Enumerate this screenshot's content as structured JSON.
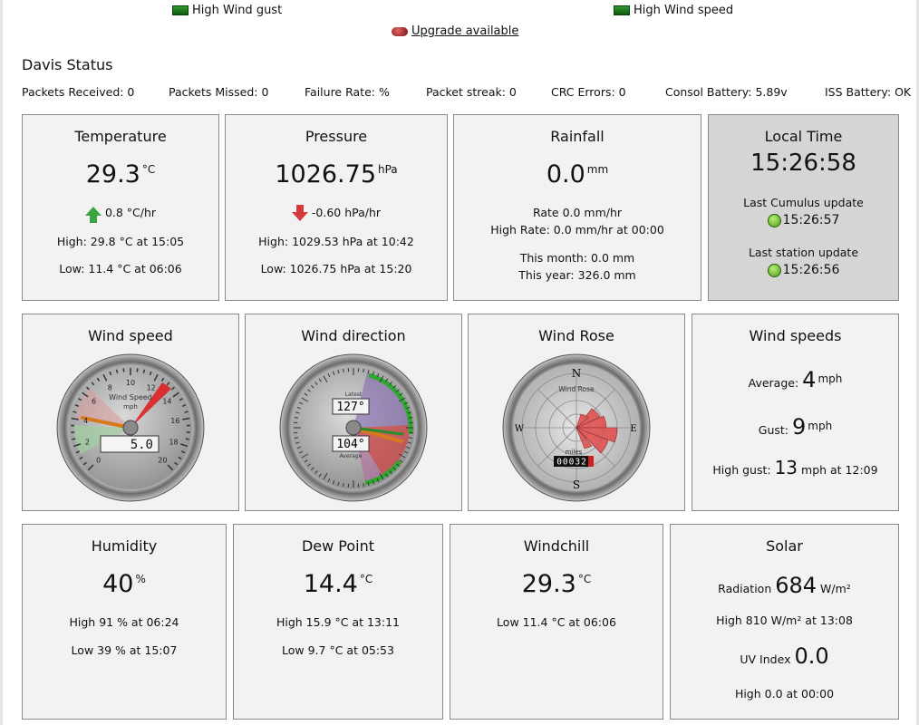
{
  "alarms": {
    "high_wind_gust": "High Wind gust",
    "high_wind_speed": "High Wind speed",
    "upgrade": "Upgrade available"
  },
  "davis": {
    "title": "Davis Status",
    "packets_received": "Packets Received: 0",
    "packets_missed": "Packets Missed: 0",
    "failure_rate": "Failure Rate: %",
    "packet_streak": "Packet streak: 0",
    "crc_errors": "CRC Errors: 0",
    "consol_battery": "Consol Battery: 5.89v",
    "iss_battery": "ISS Battery: OK"
  },
  "temperature": {
    "title": "Temperature",
    "value": "29.3",
    "unit": "°C",
    "trend": "0.8 °C/hr",
    "high": "High: 29.8 °C at 15:05",
    "low": "Low: 11.4 °C at 06:06"
  },
  "pressure": {
    "title": "Pressure",
    "value": "1026.75",
    "unit": "hPa",
    "trend": "-0.60 hPa/hr",
    "high": "High: 1029.53 hPa at 10:42",
    "low": "Low: 1026.75 hPa at 15:20"
  },
  "rainfall": {
    "title": "Rainfall",
    "value": "0.0",
    "unit": "mm",
    "rate": "Rate 0.0 mm/hr",
    "high_rate": "High Rate: 0.0 mm/hr at 00:00",
    "month": "This month: 0.0 mm",
    "year": "This year: 326.0 mm"
  },
  "local_time": {
    "title": "Local Time",
    "value": "15:26:58",
    "cumulus_label": "Last Cumulus update",
    "cumulus_time": "15:26:57",
    "station_label": "Last station update",
    "station_time": "15:26:56"
  },
  "wind_speed_gauge": {
    "title": "Wind speed",
    "gauge_title": "Wind Speed",
    "gauge_unit": "mph",
    "display": "5.0",
    "ticks": [
      "0",
      "2",
      "4",
      "6",
      "8",
      "10",
      "12",
      "14",
      "16",
      "18",
      "20"
    ]
  },
  "wind_direction_gauge": {
    "title": "Wind direction",
    "latest_label": "Latest",
    "latest": "127°",
    "average_label": "Average",
    "average": "104°"
  },
  "wind_rose": {
    "title": "Wind Rose",
    "gauge_title": "Wind Rose",
    "odometer_label": "miles",
    "odometer": "00032",
    "n": "N",
    "s": "S",
    "e": "E",
    "w": "W"
  },
  "wind_speeds": {
    "title": "Wind speeds",
    "avg_label": "Average:",
    "avg_value": "4",
    "avg_unit": "mph",
    "gust_label": "Gust:",
    "gust_value": "9",
    "gust_unit": "mph",
    "high_label": "High gust:",
    "high_value": "13",
    "high_suffix": "mph at 12:09"
  },
  "humidity": {
    "title": "Humidity",
    "value": "40",
    "unit": "%",
    "high": "High 91 % at 06:24",
    "low": "Low  39 % at 15:07"
  },
  "dew_point": {
    "title": "Dew Point",
    "value": "14.4",
    "unit": "°C",
    "high": "High 15.9 °C at 13:11",
    "low": "Low  9.7 °C at 05:53"
  },
  "windchill": {
    "title": "Windchill",
    "value": "29.3",
    "unit": "°C",
    "low": "Low  11.4 °C at 06:06"
  },
  "solar": {
    "title": "Solar",
    "radiation_label": "Radiation",
    "radiation_value": "684",
    "radiation_unit": "W/m²",
    "high": "High 810 W/m² at 13:08",
    "uv_label": "UV Index",
    "uv_value": "0.0",
    "uv_high": "High 0.0 at 00:00"
  }
}
